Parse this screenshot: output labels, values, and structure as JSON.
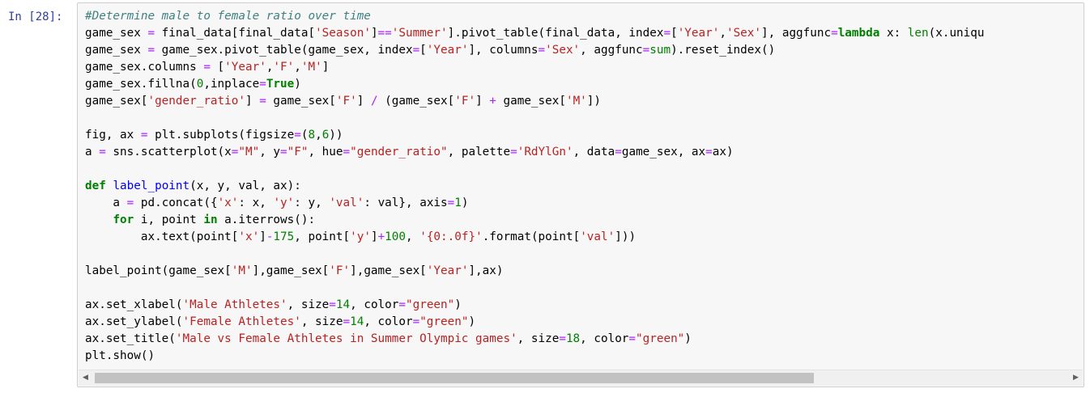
{
  "cell": {
    "prompt": "In [28]:"
  },
  "code_lines": [
    [
      {
        "t": "#Determine male to female ratio over time",
        "c": "comment"
      }
    ],
    [
      {
        "t": "game_sex "
      },
      {
        "t": "=",
        "c": "op"
      },
      {
        "t": " final_data[final_data["
      },
      {
        "t": "'Season'",
        "c": "string"
      },
      {
        "t": "]"
      },
      {
        "t": "==",
        "c": "op"
      },
      {
        "t": "'Summer'",
        "c": "string"
      },
      {
        "t": "].pivot_table(final_data, index"
      },
      {
        "t": "=",
        "c": "op"
      },
      {
        "t": "["
      },
      {
        "t": "'Year'",
        "c": "string"
      },
      {
        "t": ","
      },
      {
        "t": "'Sex'",
        "c": "string"
      },
      {
        "t": "], aggfunc"
      },
      {
        "t": "=",
        "c": "op"
      },
      {
        "t": "lambda",
        "c": "kw"
      },
      {
        "t": " x: "
      },
      {
        "t": "len",
        "c": "builtin"
      },
      {
        "t": "(x.uniqu"
      }
    ],
    [
      {
        "t": "game_sex "
      },
      {
        "t": "=",
        "c": "op"
      },
      {
        "t": " game_sex.pivot_table(game_sex, index"
      },
      {
        "t": "=",
        "c": "op"
      },
      {
        "t": "["
      },
      {
        "t": "'Year'",
        "c": "string"
      },
      {
        "t": "], columns"
      },
      {
        "t": "=",
        "c": "op"
      },
      {
        "t": "'Sex'",
        "c": "string"
      },
      {
        "t": ", aggfunc"
      },
      {
        "t": "=",
        "c": "op"
      },
      {
        "t": "sum",
        "c": "builtin"
      },
      {
        "t": ").reset_index()"
      }
    ],
    [
      {
        "t": "game_sex.columns "
      },
      {
        "t": "=",
        "c": "op"
      },
      {
        "t": " ["
      },
      {
        "t": "'Year'",
        "c": "string"
      },
      {
        "t": ","
      },
      {
        "t": "'F'",
        "c": "string"
      },
      {
        "t": ","
      },
      {
        "t": "'M'",
        "c": "string"
      },
      {
        "t": "]"
      }
    ],
    [
      {
        "t": "game_sex.fillna("
      },
      {
        "t": "0",
        "c": "num"
      },
      {
        "t": ",inplace"
      },
      {
        "t": "=",
        "c": "op"
      },
      {
        "t": "True",
        "c": "bool"
      },
      {
        "t": ")"
      }
    ],
    [
      {
        "t": "game_sex["
      },
      {
        "t": "'gender_ratio'",
        "c": "string"
      },
      {
        "t": "] "
      },
      {
        "t": "=",
        "c": "op"
      },
      {
        "t": " game_sex["
      },
      {
        "t": "'F'",
        "c": "string"
      },
      {
        "t": "] "
      },
      {
        "t": "/",
        "c": "op"
      },
      {
        "t": " (game_sex["
      },
      {
        "t": "'F'",
        "c": "string"
      },
      {
        "t": "] "
      },
      {
        "t": "+",
        "c": "op"
      },
      {
        "t": " game_sex["
      },
      {
        "t": "'M'",
        "c": "string"
      },
      {
        "t": "])"
      }
    ],
    [
      {
        "t": ""
      }
    ],
    [
      {
        "t": "fig, ax "
      },
      {
        "t": "=",
        "c": "op"
      },
      {
        "t": " plt.subplots(figsize"
      },
      {
        "t": "=",
        "c": "op"
      },
      {
        "t": "("
      },
      {
        "t": "8",
        "c": "num"
      },
      {
        "t": ","
      },
      {
        "t": "6",
        "c": "num"
      },
      {
        "t": "))"
      }
    ],
    [
      {
        "t": "a "
      },
      {
        "t": "=",
        "c": "op"
      },
      {
        "t": " sns.scatterplot(x"
      },
      {
        "t": "=",
        "c": "op"
      },
      {
        "t": "\"M\"",
        "c": "string"
      },
      {
        "t": ", y"
      },
      {
        "t": "=",
        "c": "op"
      },
      {
        "t": "\"F\"",
        "c": "string"
      },
      {
        "t": ", hue"
      },
      {
        "t": "=",
        "c": "op"
      },
      {
        "t": "\"gender_ratio\"",
        "c": "string"
      },
      {
        "t": ", palette"
      },
      {
        "t": "=",
        "c": "op"
      },
      {
        "t": "'RdYlGn'",
        "c": "string"
      },
      {
        "t": ", data"
      },
      {
        "t": "=",
        "c": "op"
      },
      {
        "t": "game_sex, ax"
      },
      {
        "t": "=",
        "c": "op"
      },
      {
        "t": "ax)"
      }
    ],
    [
      {
        "t": ""
      }
    ],
    [
      {
        "t": "def",
        "c": "kw"
      },
      {
        "t": " "
      },
      {
        "t": "label_point",
        "c": "def"
      },
      {
        "t": "(x, y, val, ax):"
      }
    ],
    [
      {
        "t": "    a "
      },
      {
        "t": "=",
        "c": "op"
      },
      {
        "t": " pd.concat({"
      },
      {
        "t": "'x'",
        "c": "string"
      },
      {
        "t": ": x, "
      },
      {
        "t": "'y'",
        "c": "string"
      },
      {
        "t": ": y, "
      },
      {
        "t": "'val'",
        "c": "string"
      },
      {
        "t": ": val}, axis"
      },
      {
        "t": "=",
        "c": "op"
      },
      {
        "t": "1",
        "c": "num"
      },
      {
        "t": ")"
      }
    ],
    [
      {
        "t": "    "
      },
      {
        "t": "for",
        "c": "kw"
      },
      {
        "t": " i, point "
      },
      {
        "t": "in",
        "c": "kw"
      },
      {
        "t": " a.iterrows():"
      }
    ],
    [
      {
        "t": "        ax.text(point["
      },
      {
        "t": "'x'",
        "c": "string"
      },
      {
        "t": "]"
      },
      {
        "t": "-",
        "c": "op"
      },
      {
        "t": "175",
        "c": "num"
      },
      {
        "t": ", point["
      },
      {
        "t": "'y'",
        "c": "string"
      },
      {
        "t": "]"
      },
      {
        "t": "+",
        "c": "op"
      },
      {
        "t": "100",
        "c": "num"
      },
      {
        "t": ", "
      },
      {
        "t": "'{0:.0f}'",
        "c": "string"
      },
      {
        "t": ".format(point["
      },
      {
        "t": "'val'",
        "c": "string"
      },
      {
        "t": "]))"
      }
    ],
    [
      {
        "t": ""
      }
    ],
    [
      {
        "t": "label_point(game_sex["
      },
      {
        "t": "'M'",
        "c": "string"
      },
      {
        "t": "],game_sex["
      },
      {
        "t": "'F'",
        "c": "string"
      },
      {
        "t": "],game_sex["
      },
      {
        "t": "'Year'",
        "c": "string"
      },
      {
        "t": "],ax)"
      }
    ],
    [
      {
        "t": ""
      }
    ],
    [
      {
        "t": "ax.set_xlabel("
      },
      {
        "t": "'Male Athletes'",
        "c": "string"
      },
      {
        "t": ", size"
      },
      {
        "t": "=",
        "c": "op"
      },
      {
        "t": "14",
        "c": "num"
      },
      {
        "t": ", color"
      },
      {
        "t": "=",
        "c": "op"
      },
      {
        "t": "\"green\"",
        "c": "string"
      },
      {
        "t": ")"
      }
    ],
    [
      {
        "t": "ax.set_ylabel("
      },
      {
        "t": "'Female Athletes'",
        "c": "string"
      },
      {
        "t": ", size"
      },
      {
        "t": "=",
        "c": "op"
      },
      {
        "t": "14",
        "c": "num"
      },
      {
        "t": ", color"
      },
      {
        "t": "=",
        "c": "op"
      },
      {
        "t": "\"green\"",
        "c": "string"
      },
      {
        "t": ")"
      }
    ],
    [
      {
        "t": "ax.set_title("
      },
      {
        "t": "'Male vs Female Athletes in Summer Olympic games'",
        "c": "string"
      },
      {
        "t": ", size"
      },
      {
        "t": "=",
        "c": "op"
      },
      {
        "t": "18",
        "c": "num"
      },
      {
        "t": ", color"
      },
      {
        "t": "=",
        "c": "op"
      },
      {
        "t": "\"green\"",
        "c": "string"
      },
      {
        "t": ")"
      }
    ],
    [
      {
        "t": "plt.show()"
      }
    ]
  ],
  "scrollbar": {
    "left_arrow": "◀",
    "right_arrow": "▶",
    "thumb_fraction": 0.74
  },
  "colors": {
    "prompt": "#303f9f",
    "comment": "#408080",
    "string": "#ba2121",
    "keyword": "#008000",
    "operator": "#aa22ff",
    "cell_background": "#f7f7f7",
    "cell_border": "#cfcfcf"
  }
}
